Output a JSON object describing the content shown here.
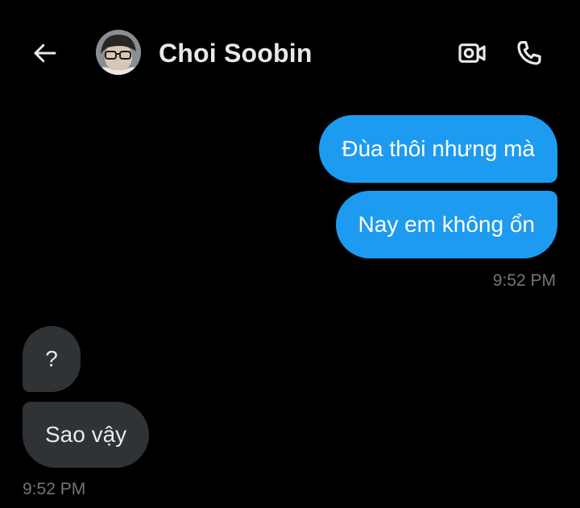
{
  "header": {
    "contact_name": "Choi Soobin",
    "icons": {
      "back": "arrow-left-icon",
      "video": "video-call-icon",
      "phone": "phone-call-icon"
    }
  },
  "messages": [
    {
      "direction": "sent",
      "text": "Đùa thôi nhưng mà"
    },
    {
      "direction": "sent",
      "text": "Nay em không ổn"
    },
    {
      "direction": "received",
      "text": "?"
    },
    {
      "direction": "received",
      "text": "Sao vậy"
    }
  ],
  "timestamps": {
    "sent_group": "9:52 PM",
    "received_group": "9:52 PM"
  },
  "colors": {
    "background": "#000000",
    "sent_bubble": "#1d9bf0",
    "received_bubble": "#2f3336",
    "timestamp": "#71767b",
    "primary_text": "#e7e9ea"
  }
}
